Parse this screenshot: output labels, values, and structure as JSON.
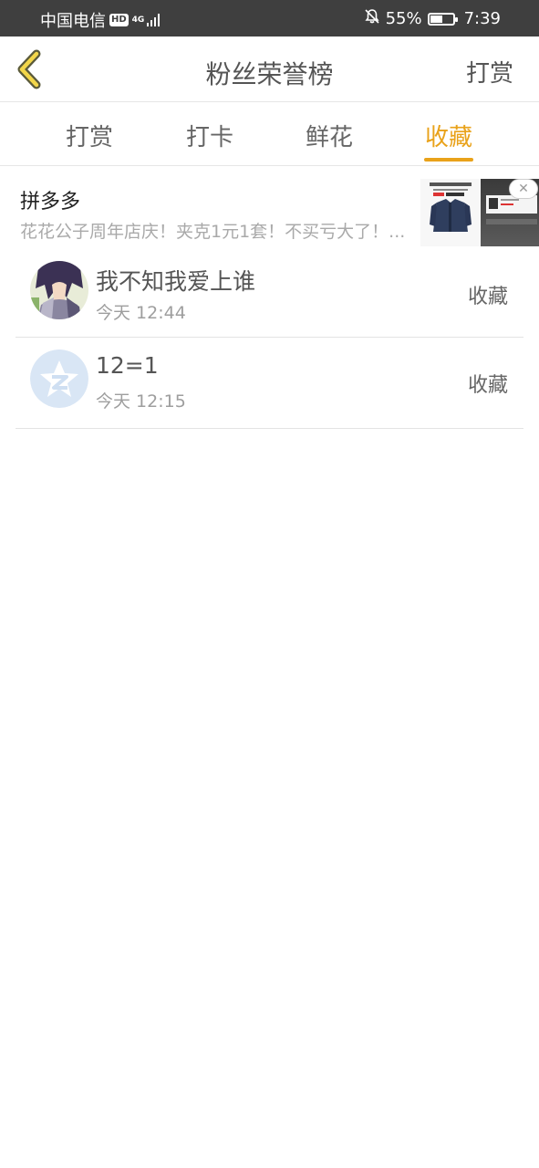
{
  "status_bar": {
    "carrier": "中国电信",
    "hd_badge": "HD",
    "network": "4G",
    "battery": "55%",
    "battery_level": 0.55,
    "time": "7:39"
  },
  "header": {
    "title": "粉丝荣誉榜",
    "right_link": "打赏",
    "back_icon": "chevron-left-icon"
  },
  "tabs": [
    {
      "label": "打赏",
      "active": false
    },
    {
      "label": "打卡",
      "active": false
    },
    {
      "label": "鲜花",
      "active": false
    },
    {
      "label": "收藏",
      "active": true
    }
  ],
  "ad": {
    "brand": "拼多多",
    "description": "花花公子周年店庆！夹克1元1套！不买亏大了！...",
    "close_icon": "close-icon"
  },
  "list": [
    {
      "name": "我不知我爱上谁",
      "time": "今天 12:44",
      "action": "收藏",
      "avatar": "anime-avatar"
    },
    {
      "name": "12=1",
      "time": "今天 12:15",
      "action": "收藏",
      "avatar": "default-avatar"
    }
  ],
  "colors": {
    "accent": "#e9a21a",
    "status_bar": "#3f3f3f",
    "title_text": "#555555",
    "subtle_text": "#9e9e9e"
  }
}
